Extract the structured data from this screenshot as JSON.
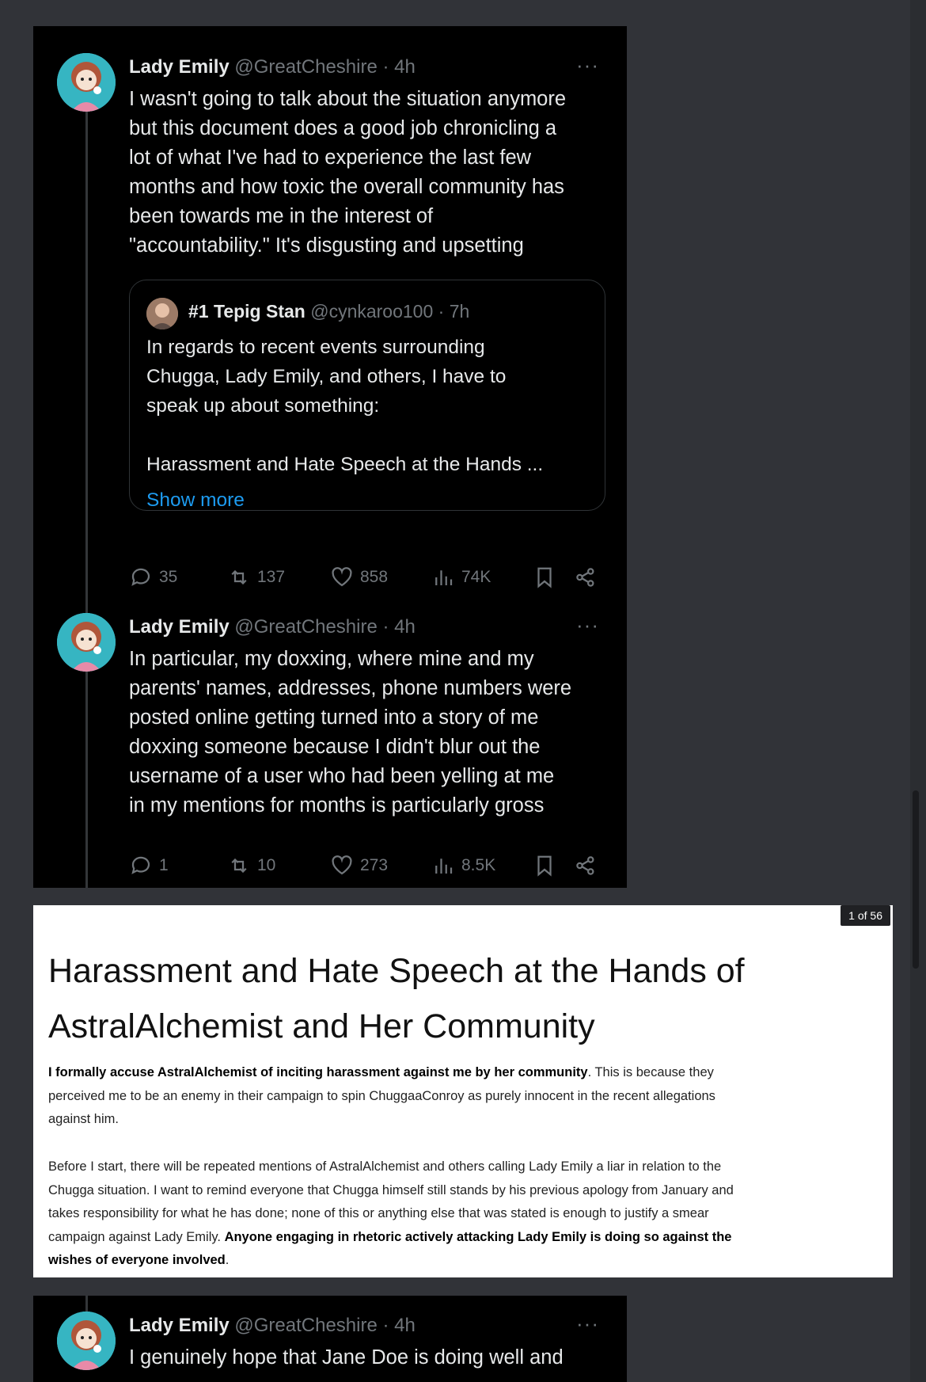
{
  "tweets": [
    {
      "name": "Lady Emily",
      "handle": "@GreatCheshire · 4h",
      "more": "···",
      "text": "I wasn't going to talk about the situation anymore\nbut this document does a good job chronicling a\nlot of what I've had to experience the last few\nmonths and how toxic the overall community has\nbeen towards me in the interest of\n\"accountability.\" It's disgusting and upsetting",
      "quote": {
        "name": "#1 Tepig Stan",
        "handle": "@cynkaroo100 · 7h",
        "text": "In regards to recent events surrounding\nChugga, Lady Emily, and others, I have to\nspeak up about something:\n\nHarassment and Hate Speech at the Hands ...",
        "show_more": "Show more"
      },
      "stats": {
        "replies": "35",
        "retweets": "137",
        "likes": "858",
        "views": "74K"
      }
    },
    {
      "name": "Lady Emily",
      "handle": "@GreatCheshire · 4h",
      "more": "···",
      "text": "In particular, my doxxing, where mine and my\nparents' names, addresses, phone numbers were\nposted online getting turned into a story of me\ndoxxing someone because I didn't blur out the\nusername of a user who had been yelling at me\nin my mentions for months is particularly gross",
      "stats": {
        "replies": "1",
        "retweets": "10",
        "likes": "273",
        "views": "8.5K"
      }
    },
    {
      "name": "Lady Emily",
      "handle": "@GreatCheshire · 4h",
      "more": "···",
      "text": "I genuinely hope that Jane Doe is doing well and"
    }
  ],
  "document": {
    "page_badge": "1 of 56",
    "title": "Harassment and Hate Speech at the Hands of AstralAlchemist and Her Community",
    "p1_bold": "I formally accuse AstralAlchemist of inciting harassment against me by her community",
    "p1_rest": ". This is because they perceived me to be an enemy in their campaign to spin ChuggaaConroy as purely innocent in the recent allegations against him.",
    "p2_text": "Before I start, there will be repeated mentions of AstralAlchemist and others calling Lady Emily a liar in relation to the Chugga situation. I want to remind everyone that Chugga himself still stands by his previous apology from January and takes responsibility for what he has done; none of this or anything else that was stated is enough to justify a smear campaign against Lady Emily. ",
    "p2_bold": "Anyone engaging in rhetoric actively attacking Lady Emily is doing so against the wishes of everyone involved",
    "p2_end": "."
  },
  "colors": {
    "page_bg": "#313338",
    "tweet_bg": "#000000",
    "text": "#e7e9ea",
    "muted": "#71767b",
    "link": "#1d9bf0",
    "avatar_bg": "#36b5c2"
  },
  "icons": [
    "reply-icon",
    "retweet-icon",
    "like-icon",
    "views-icon",
    "bookmark-icon",
    "share-icon"
  ]
}
